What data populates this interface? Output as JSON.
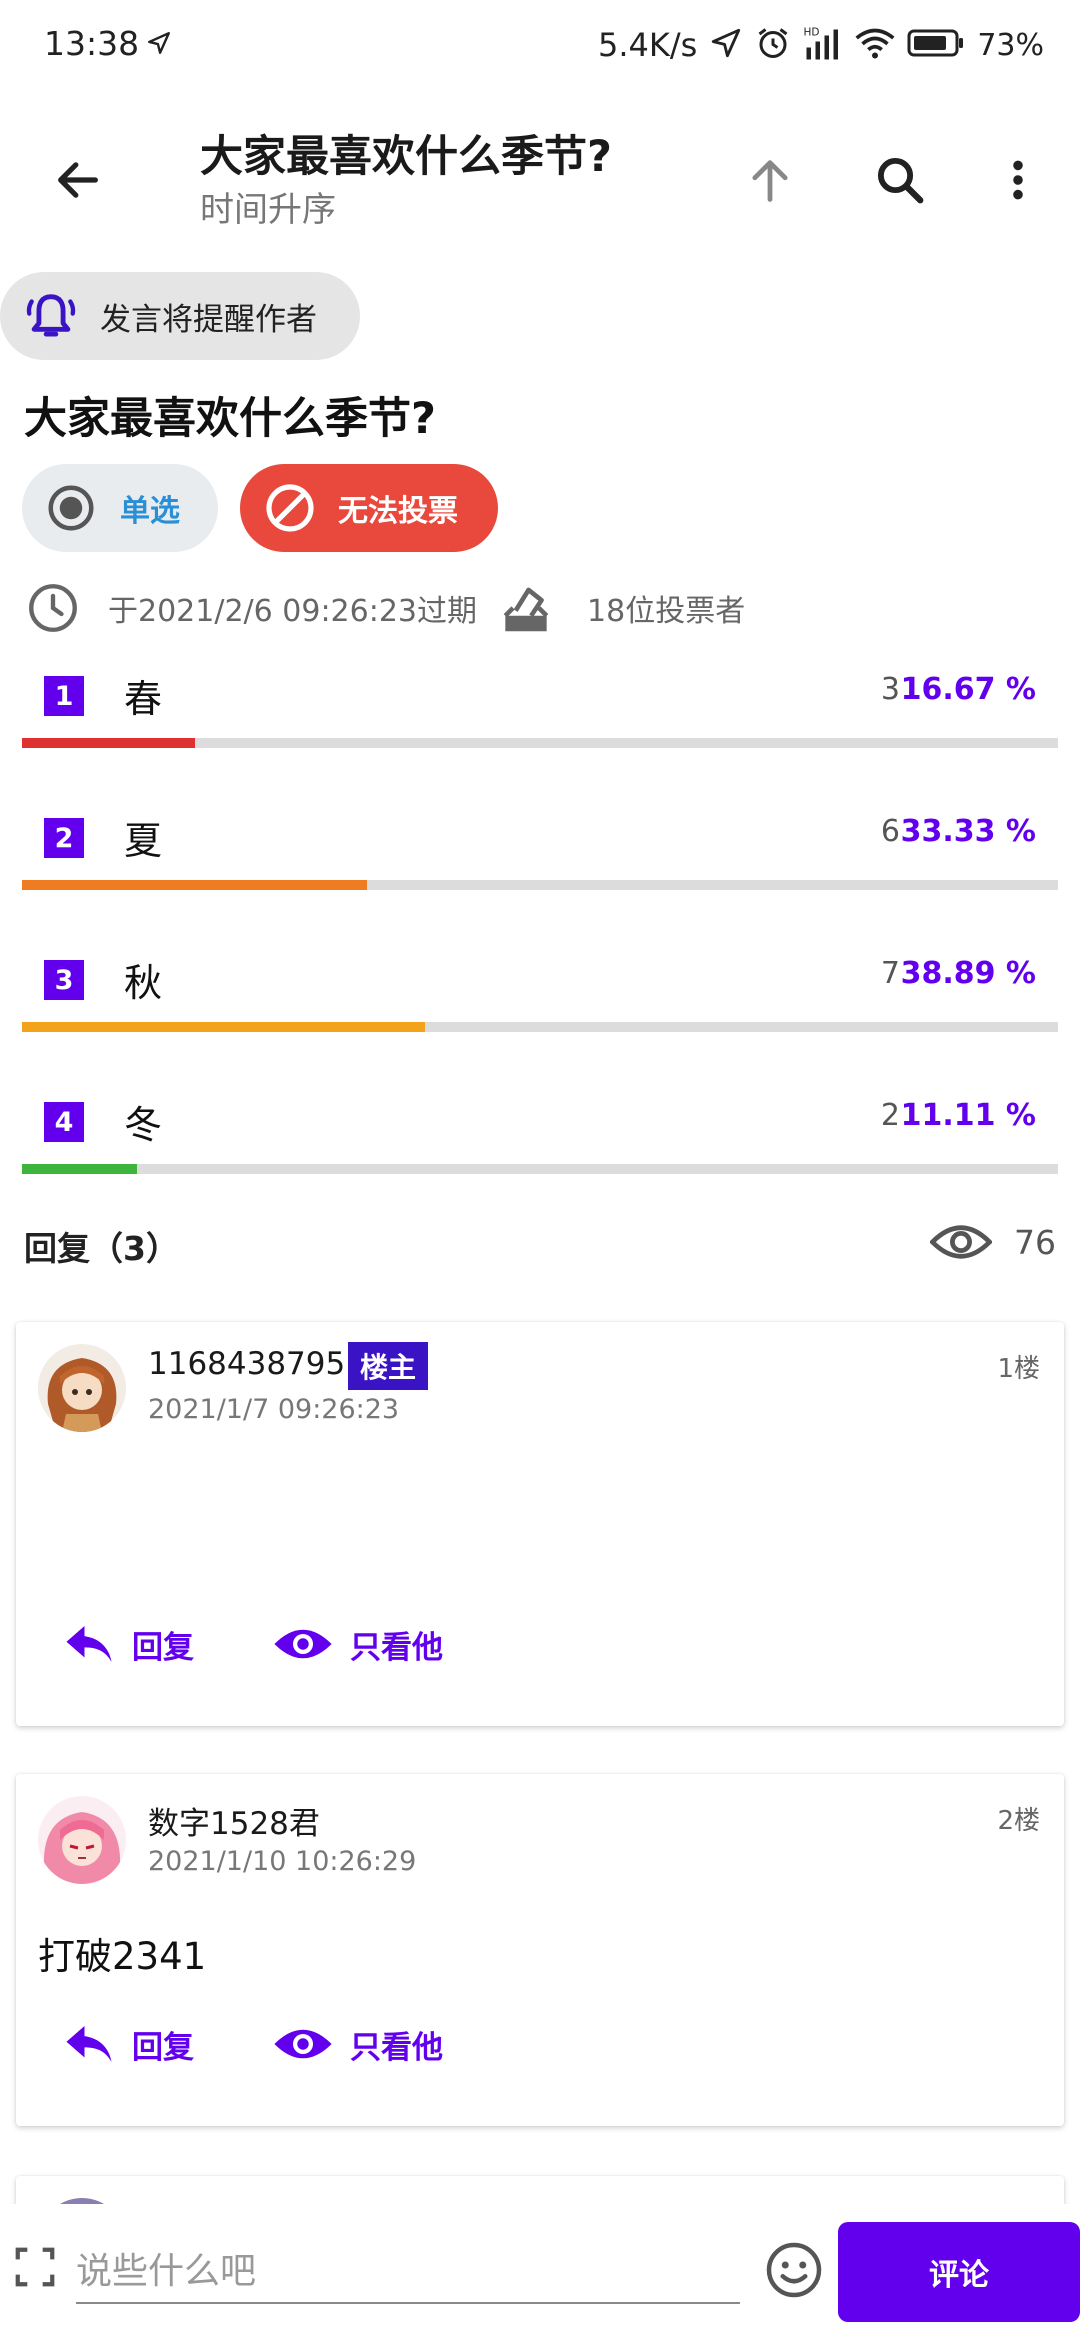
{
  "status_bar": {
    "time": "13:38",
    "net_speed": "5.4K/s",
    "battery": "73%"
  },
  "appbar": {
    "title": "大家最喜欢什么季节?",
    "subtitle": "时间升序"
  },
  "remind_chip": {
    "label": "发言将提醒作者"
  },
  "poll": {
    "title": "大家最喜欢什么季节?",
    "mode_label": "单选",
    "status_label": "无法投票",
    "expire_text": "于2021/2/6 09:26:23过期",
    "voters_text": "18位投票者",
    "options": [
      {
        "num": "1",
        "label": "春",
        "count": "3",
        "percent": "16.67 %",
        "fraction": 0.1667,
        "color": "#e03131"
      },
      {
        "num": "2",
        "label": "夏",
        "count": "6",
        "percent": "33.33 %",
        "fraction": 0.3333,
        "color": "#f07c22"
      },
      {
        "num": "3",
        "label": "秋",
        "count": "7",
        "percent": "38.89 %",
        "fraction": 0.3889,
        "color": "#f2a31b"
      },
      {
        "num": "4",
        "label": "冬",
        "count": "2",
        "percent": "11.11 %",
        "fraction": 0.1111,
        "color": "#3db53d"
      }
    ]
  },
  "replies": {
    "header": "回复（3）",
    "views": "76"
  },
  "posts": [
    {
      "username": "1168438795",
      "badge": "楼主",
      "time": "2021/1/7 09:26:23",
      "floor": "1楼",
      "content": "",
      "reply_label": "回复",
      "only_label": "只看他"
    },
    {
      "username": "数字1528君",
      "time": "2021/1/10 10:26:29",
      "floor": "2楼",
      "content": "打破2341",
      "reply_label": "回复",
      "only_label": "只看他"
    }
  ],
  "colors": {
    "accent": "#6200ee",
    "badge": "#3a13c4",
    "no_vote": "#e8493c"
  },
  "bottom_bar": {
    "placeholder": "说些什么吧",
    "send_label": "评论"
  }
}
